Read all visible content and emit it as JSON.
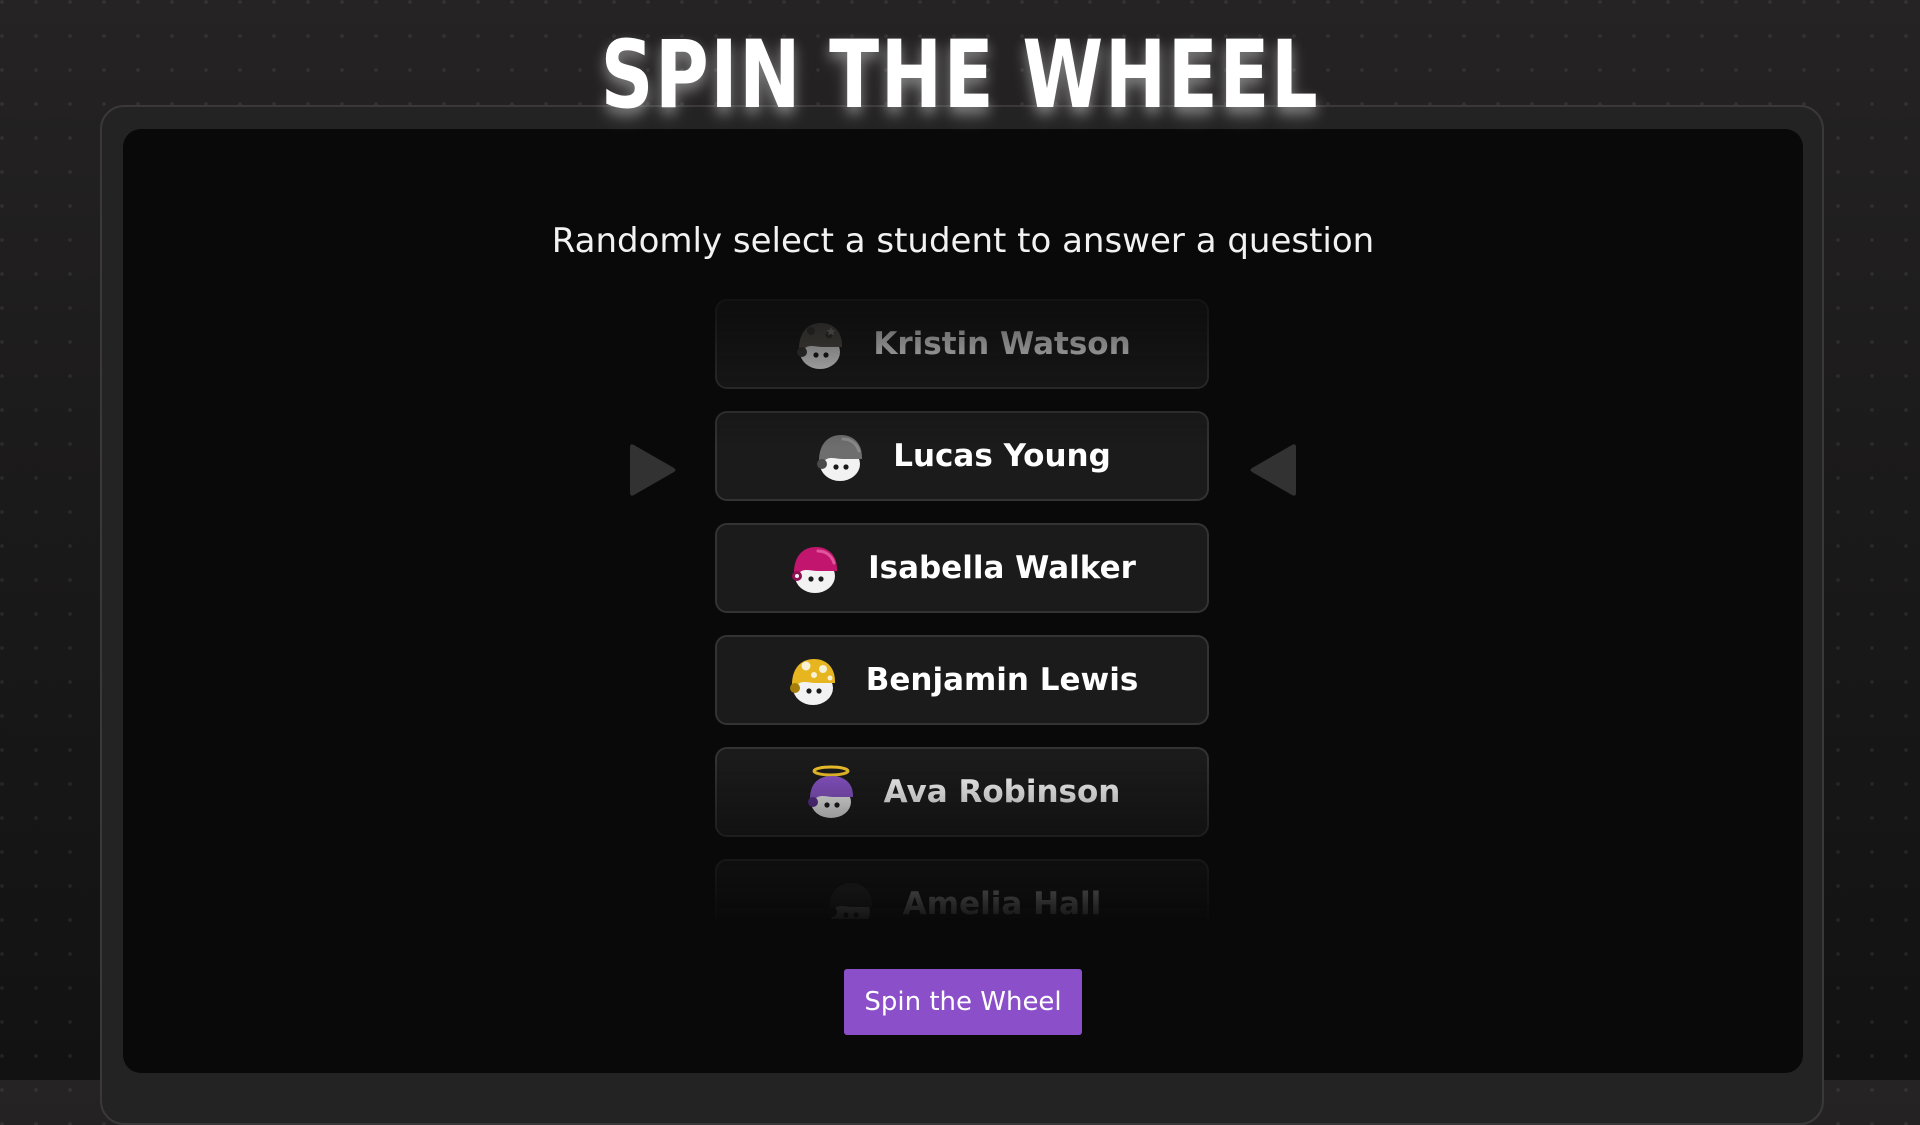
{
  "header": {
    "title": "SPIN THE WHEEL"
  },
  "panel": {
    "subtitle": "Randomly select a student to answer a question",
    "spin_button_label": "Spin the Wheel"
  },
  "students": [
    {
      "name": "Kristin Watson",
      "avatar_icon": "gray-camo-helmet-avatar-icon",
      "helmet_color": "#5a5550"
    },
    {
      "name": "Lucas Young",
      "avatar_icon": "gray-helmet-avatar-icon",
      "helmet_color": "#6e6e6e"
    },
    {
      "name": "Isabella Walker",
      "avatar_icon": "magenta-helmet-avatar-icon",
      "helmet_color": "#c2166e"
    },
    {
      "name": "Benjamin Lewis",
      "avatar_icon": "yellow-camo-helmet-avatar-icon",
      "helmet_color": "#e6b520"
    },
    {
      "name": "Ava Robinson",
      "avatar_icon": "purple-halo-helmet-avatar-icon",
      "helmet_color": "#8a55c9"
    },
    {
      "name": "Amelia Hall",
      "avatar_icon": "dark-helmet-avatar-icon",
      "helmet_color": "#3a3a3a"
    }
  ],
  "colors": {
    "accent": "#8a4fc9",
    "card_background": "#1b1b1b",
    "panel_background": "#090909"
  }
}
